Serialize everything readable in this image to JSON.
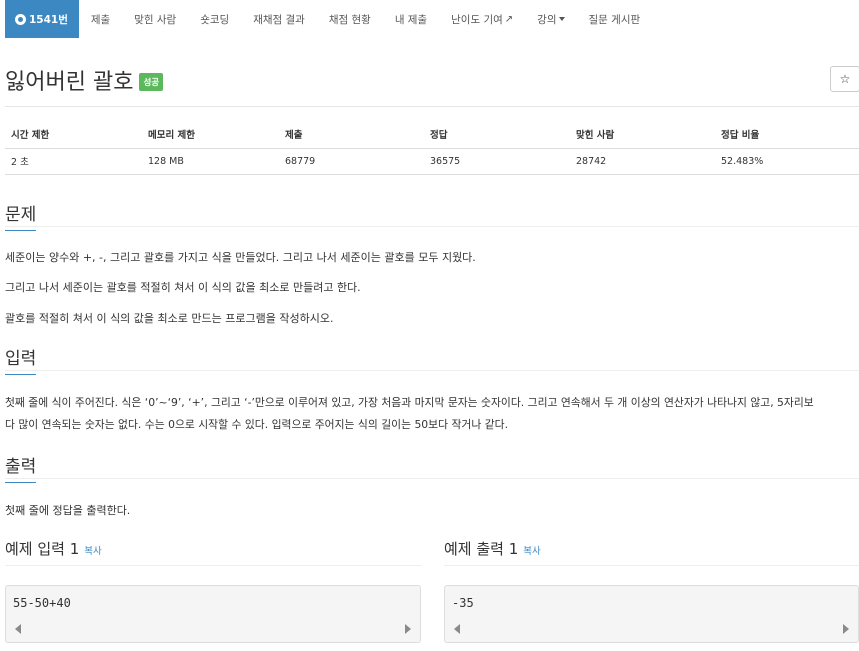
{
  "nav": {
    "active_label": "1541번",
    "items": [
      "제출",
      "맞힌 사람",
      "숏코딩",
      "재채점 결과",
      "채점 현황",
      "내 제출",
      "난이도 기여",
      "강의",
      "질문 게시판"
    ]
  },
  "problem": {
    "title": "잃어버린 괄호",
    "result_label": "성공",
    "star": "☆"
  },
  "info": {
    "headers": [
      "시간 제한",
      "메모리 제한",
      "제출",
      "정답",
      "맞힌 사람",
      "정답 비율"
    ],
    "values": [
      "2 초",
      "128 MB",
      "68779",
      "36575",
      "28742",
      "52.483%"
    ]
  },
  "sections": {
    "problem": {
      "title": "문제",
      "paragraphs": [
        "세준이는 양수와 +, -, 그리고 괄호를 가지고 식을 만들었다. 그리고 나서 세준이는 괄호를 모두 지웠다.",
        "그리고 나서 세준이는 괄호를 적절히 쳐서 이 식의 값을 최소로 만들려고 한다.",
        "괄호를 적절히 쳐서 이 식의 값을 최소로 만드는 프로그램을 작성하시오."
      ]
    },
    "input": {
      "title": "입력",
      "line1": "첫째 줄에 식이 주어진다. 식은 ‘0’~‘9’, ‘+’, 그리고 ‘-’만으로 이루어져 있고, 가장 처음과 마지막 문자는 숫자이다. 그리고 연속해서 두 개 이상의 연산자가 나타나지 않고, 5자리보",
      "line2": "다 많이 연속되는 숫자는 없다. 수는 0으로 시작할 수 있다. 입력으로 주어지는 식의 길이는 50보다 작거나 같다."
    },
    "output": {
      "title": "출력",
      "text": "첫째 줄에 정답을 출력한다."
    }
  },
  "samples": {
    "input_title": "예제 입력 1",
    "output_title": "예제 출력 1",
    "copy_label": "복사",
    "input_value": "55-50+40",
    "output_value": "-35"
  },
  "colors": {
    "accent": "#3b88c3",
    "success": "#5cb85c"
  }
}
